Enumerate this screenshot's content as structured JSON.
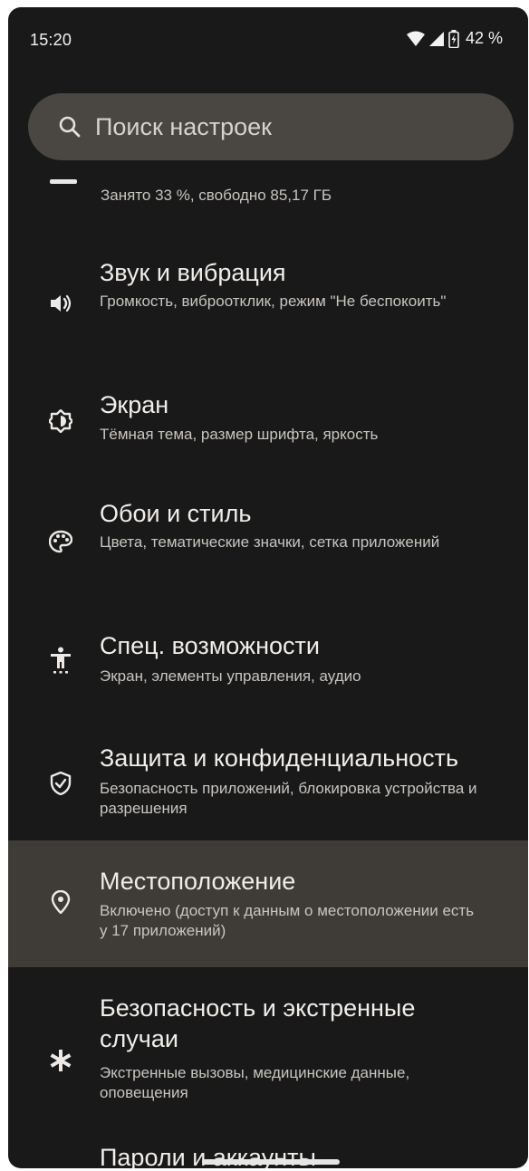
{
  "status_bar": {
    "time": "15:20",
    "battery_percent": "42 %",
    "icons": [
      "wifi-icon",
      "cell-signal-icon",
      "battery-charging-icon"
    ]
  },
  "search": {
    "placeholder": "Поиск настроек"
  },
  "storage": {
    "subtitle": "Занято 33 %, свободно 85,17 ГБ"
  },
  "items": [
    {
      "icon": "volume-icon",
      "title": "Звук и вибрация",
      "subtitle": "Громкость, виброотклик, режим \"Не беспокоить\""
    },
    {
      "icon": "brightness-icon",
      "title": "Экран",
      "subtitle": "Тёмная тема, размер шрифта, яркость"
    },
    {
      "icon": "palette-icon",
      "title": "Обои и стиль",
      "subtitle": "Цвета, тематические значки, сетка приложений"
    },
    {
      "icon": "accessibility-icon",
      "title": "Спец. возможности",
      "subtitle": "Экран, элементы управления, аудио"
    },
    {
      "icon": "shield-check-icon",
      "title": "Защита и конфиденциальность",
      "subtitle": "Безопасность приложений, блокировка устройства и разрешения"
    },
    {
      "icon": "location-pin-icon",
      "title": "Местоположение",
      "subtitle": "Включено (доступ к данным о местоположении есть у 17 приложений)"
    },
    {
      "icon": "asterisk-icon",
      "title": "Безопасность и экстренные случаи",
      "subtitle": "Экстренные вызовы, медицинские данные, оповещения"
    },
    {
      "icon": "key-icon",
      "title": "Пароли и аккаунты",
      "subtitle": ""
    }
  ],
  "colors": {
    "background": "#191919",
    "search_bar": "#4a4641",
    "selected_row": "#3f3c38",
    "text_primary": "#f1eeea",
    "text_secondary": "#c9c5c0"
  }
}
